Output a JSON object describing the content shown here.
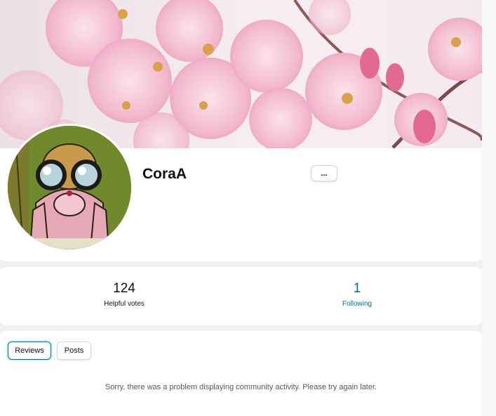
{
  "profile": {
    "username": "CoraA",
    "more_label": "..."
  },
  "stats": {
    "helpful_votes": {
      "value": "124",
      "label": "Helpful votes"
    },
    "following": {
      "value": "1",
      "label": "Following"
    }
  },
  "activity": {
    "tabs": [
      {
        "label": "Reviews",
        "selected": true
      },
      {
        "label": "Posts",
        "selected": false
      }
    ],
    "error_message": "Sorry, there was a problem displaying community activity. Please try again later."
  },
  "colors": {
    "link": "#007185",
    "selected_tab_border": "#007185",
    "page_background": "#eef1f1",
    "cover_blossom": "#f4b8cf"
  },
  "images": {
    "cover": "cherry-blossom-banner",
    "avatar": "pink-panther-binoculars"
  }
}
